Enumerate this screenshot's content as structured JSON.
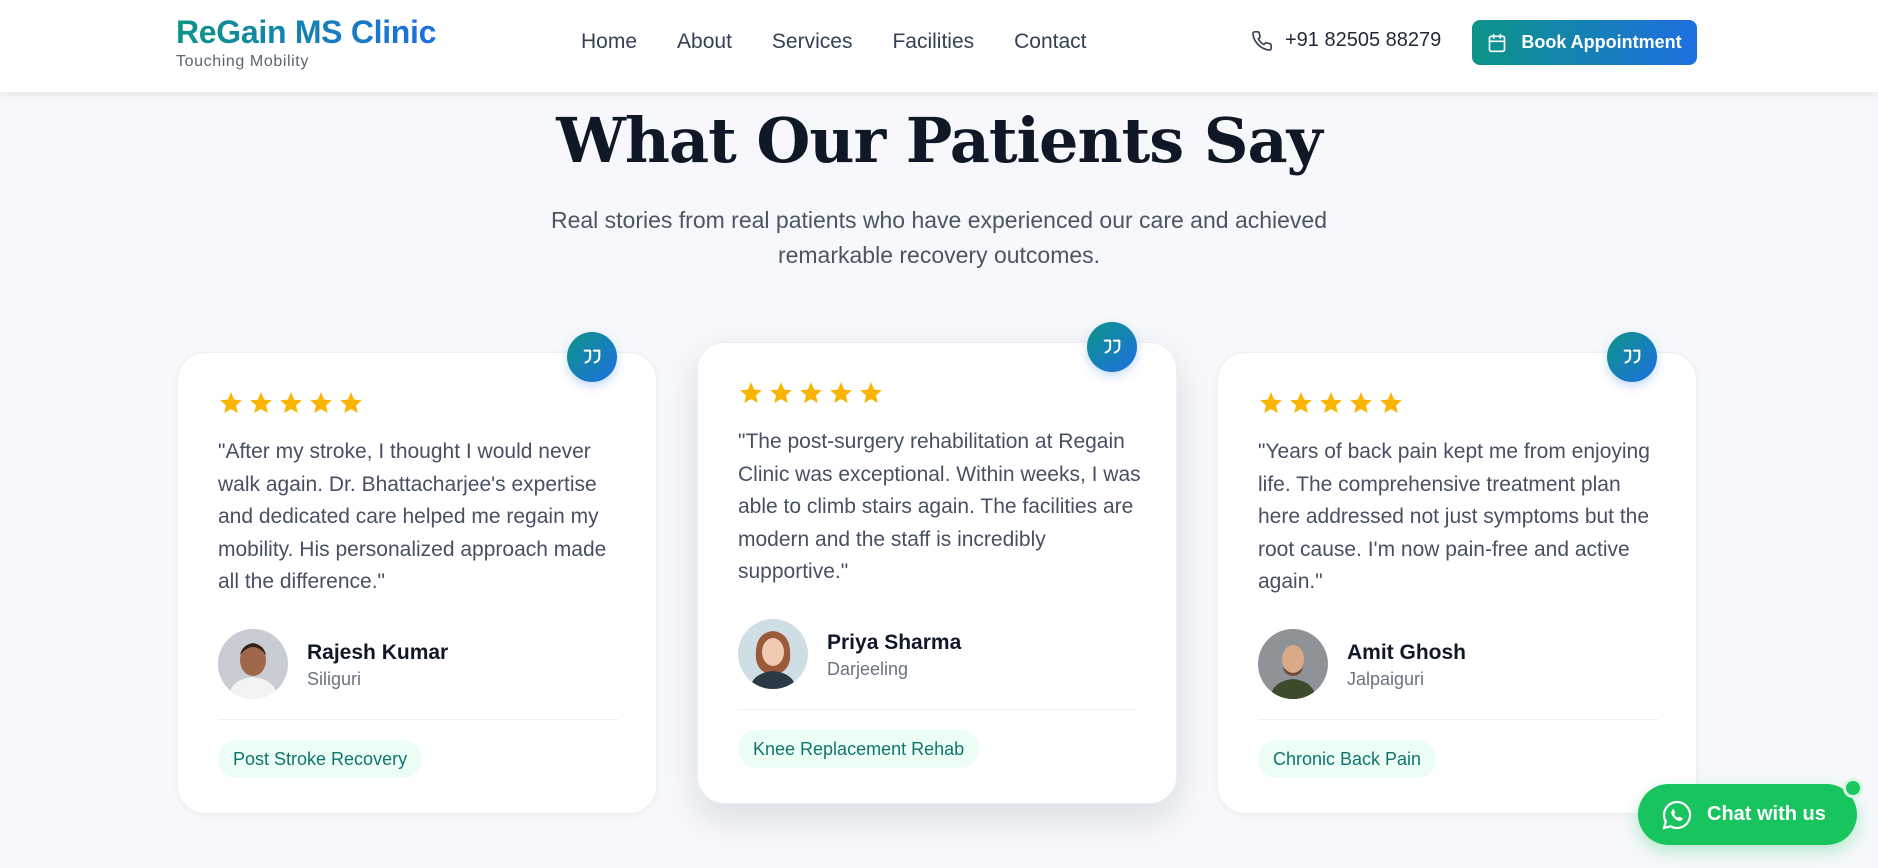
{
  "header": {
    "brand_title": "ReGain MS Clinic",
    "brand_tagline": "Touching Mobility",
    "nav": [
      "Home",
      "About",
      "Services",
      "Facilities",
      "Contact"
    ],
    "phone": "+91 82505 88279",
    "book_label": "Book Appointment"
  },
  "section": {
    "title": "What Our Patients Say",
    "subtitle": "Real stories from real patients who have experienced our care and achieved remarkable recovery outcomes."
  },
  "testimonials": [
    {
      "rating": 5,
      "quote": "\"After my stroke, I thought I would never walk again. Dr. Bhattacharjee's expertise and dedicated care helped me regain my mobility. His personalized approach made all the difference.\"",
      "name": "Rajesh Kumar",
      "city": "Siliguri",
      "tag": "Post Stroke Recovery"
    },
    {
      "rating": 5,
      "quote": "\"The post-surgery rehabilitation at Regain Clinic was exceptional. Within weeks, I was able to climb stairs again. The facilities are modern and the staff is incredibly supportive.\"",
      "name": "Priya Sharma",
      "city": "Darjeeling",
      "tag": "Knee Replacement Rehab"
    },
    {
      "rating": 5,
      "quote": "\"Years of back pain kept me from enjoying life. The comprehensive treatment plan here addressed not just symptoms but the root cause. I'm now pain-free and active again.\"",
      "name": "Amit Ghosh",
      "city": "Jalpaiguri",
      "tag": "Chronic Back Pain"
    }
  ],
  "chat": {
    "label": "Chat with us"
  },
  "colors": {
    "brand_start": "#0d9488",
    "brand_end": "#1d6fe0",
    "star": "#fbb500",
    "whatsapp": "#17c45e",
    "tag_bg": "#ecfdf5",
    "tag_text": "#0f766e"
  },
  "icons": {
    "phone": "phone-icon",
    "calendar": "calendar-icon",
    "quote": "quote-icon",
    "star": "star-icon",
    "whatsapp": "whatsapp-icon"
  }
}
